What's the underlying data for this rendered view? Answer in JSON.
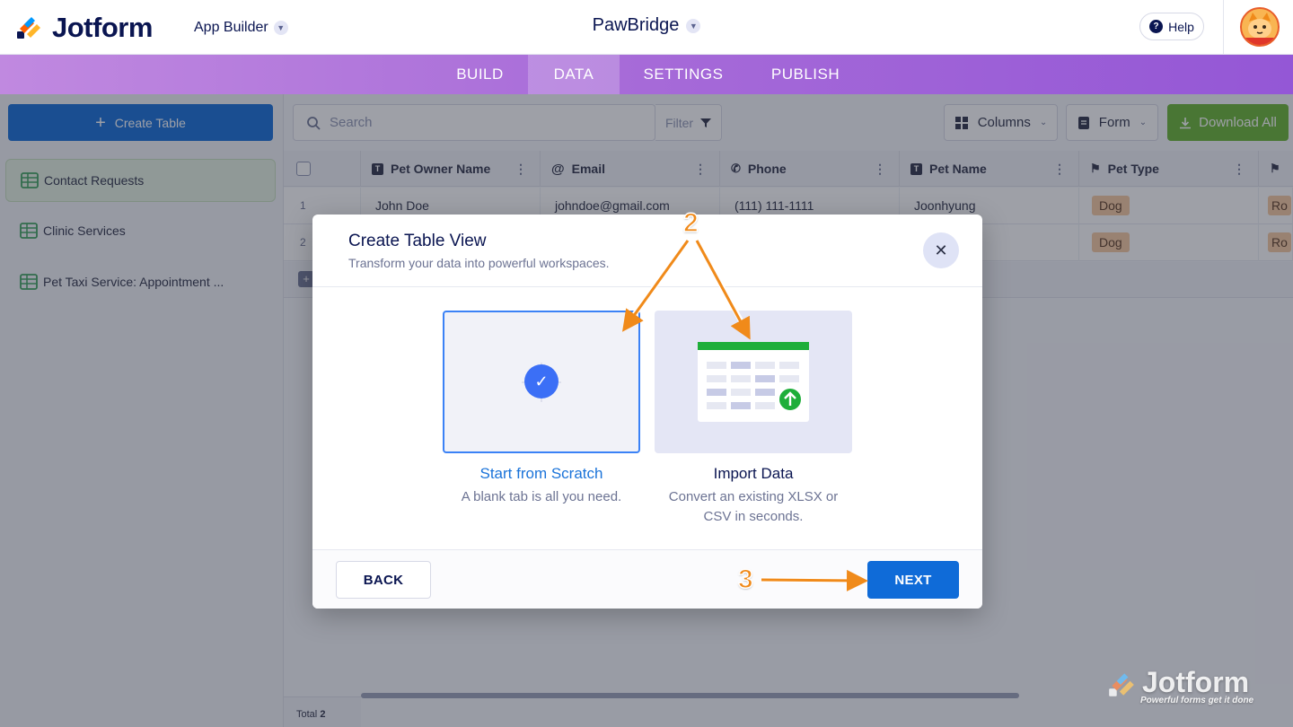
{
  "header": {
    "logo_text": "Jotform",
    "app_builder_label": "App Builder",
    "app_title": "PawBridge",
    "help_label": "Help"
  },
  "nav": {
    "tabs": [
      {
        "label": "BUILD",
        "active": false
      },
      {
        "label": "DATA",
        "active": true
      },
      {
        "label": "SETTINGS",
        "active": false
      },
      {
        "label": "PUBLISH",
        "active": false
      }
    ]
  },
  "sidebar": {
    "create_table_label": "Create Table",
    "items": [
      {
        "label": "Contact Requests",
        "active": true
      },
      {
        "label": "Clinic Services",
        "active": false
      },
      {
        "label": "Pet Taxi Service: Appointment ...",
        "active": false
      }
    ]
  },
  "toolbar": {
    "search_placeholder": "Search",
    "filter_label": "Filter",
    "columns_label": "Columns",
    "form_label": "Form",
    "download_label": "Download All"
  },
  "table": {
    "columns": [
      {
        "label": "Pet Owner Name",
        "icon": "text-icon"
      },
      {
        "label": "Email",
        "icon": "at-icon"
      },
      {
        "label": "Phone",
        "icon": "phone-icon"
      },
      {
        "label": "Pet Name",
        "icon": "text-icon"
      },
      {
        "label": "Pet Type",
        "icon": "tag-icon"
      }
    ],
    "rows": [
      {
        "num": "1",
        "owner": "John Doe",
        "email": "johndoe@gmail.com",
        "phone": "(111) 111-1111",
        "pet_name": "Joonhyung",
        "pet_type": "Dog",
        "extra": "Ro"
      },
      {
        "num": "2",
        "owner": "",
        "email": "",
        "phone": "",
        "pet_name": "",
        "pet_type": "Dog",
        "extra": "Ro"
      }
    ],
    "total_label": "Total",
    "total_count": "2"
  },
  "modal": {
    "title": "Create Table View",
    "subtitle": "Transform your data into powerful workspaces.",
    "options": [
      {
        "label": "Start from Scratch",
        "desc": "A blank tab is all you need.",
        "selected": true
      },
      {
        "label": "Import Data",
        "desc": "Convert an existing XLSX or CSV in seconds.",
        "selected": false
      }
    ],
    "back_label": "BACK",
    "next_label": "NEXT"
  },
  "annotations": {
    "step2": "2",
    "step3": "3"
  },
  "watermark": {
    "text": "Jotform",
    "tagline": "Powerful forms get it done"
  },
  "colors": {
    "primary_blue": "#0f6bd8",
    "nav_purple": "#a66ad8",
    "download_green": "#64b22f",
    "annotation_orange": "#f08a1a",
    "tag_orange": "#f6c89f"
  }
}
